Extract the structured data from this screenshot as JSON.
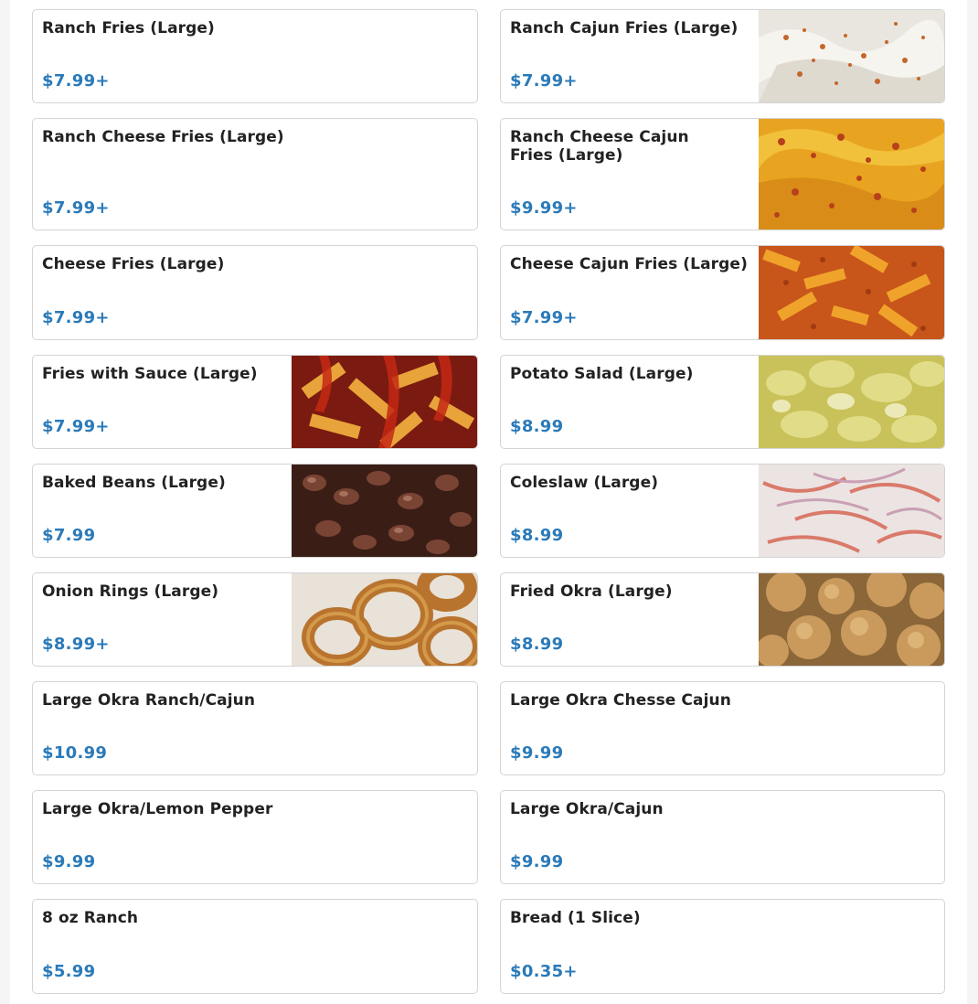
{
  "menu": {
    "items": [
      {
        "name": "Ranch Fries (Large)",
        "price": "$7.99+"
      },
      {
        "name": "Ranch Cajun Fries (Large)",
        "price": "$7.99+",
        "image": "ranch-cajun-fries-photo"
      },
      {
        "name": "Ranch Cheese Fries (Large)",
        "price": "$7.99+"
      },
      {
        "name": "Ranch Cheese Cajun Fries (Large)",
        "price": "$9.99+",
        "image": "ranch-cheese-cajun-fries-photo"
      },
      {
        "name": "Cheese Fries (Large)",
        "price": "$7.99+"
      },
      {
        "name": "Cheese Cajun Fries (Large)",
        "price": "$7.99+",
        "image": "cheese-cajun-fries-photo"
      },
      {
        "name": "Fries with Sauce (Large)",
        "price": "$7.99+",
        "image": "fries-with-sauce-photo"
      },
      {
        "name": "Potato Salad (Large)",
        "price": "$8.99",
        "image": "potato-salad-photo"
      },
      {
        "name": "Baked Beans (Large)",
        "price": "$7.99",
        "image": "baked-beans-photo"
      },
      {
        "name": "Coleslaw (Large)",
        "price": "$8.99",
        "image": "coleslaw-photo"
      },
      {
        "name": "Onion Rings (Large)",
        "price": "$8.99+",
        "image": "onion-rings-photo"
      },
      {
        "name": "Fried Okra (Large)",
        "price": "$8.99",
        "image": "fried-okra-photo"
      },
      {
        "name": "Large Okra Ranch/Cajun",
        "price": "$10.99"
      },
      {
        "name": "Large Okra Chesse Cajun",
        "price": "$9.99"
      },
      {
        "name": "Large Okra/Lemon Pepper",
        "price": "$9.99"
      },
      {
        "name": "Large Okra/Cajun",
        "price": "$9.99"
      },
      {
        "name": "8 oz Ranch",
        "price": "$5.99"
      },
      {
        "name": "Bread (1 Slice)",
        "price": "$0.35+"
      }
    ]
  },
  "colors": {
    "price": "#2a7ab9",
    "title": "#222222",
    "card_border": "#d4d4d4"
  }
}
